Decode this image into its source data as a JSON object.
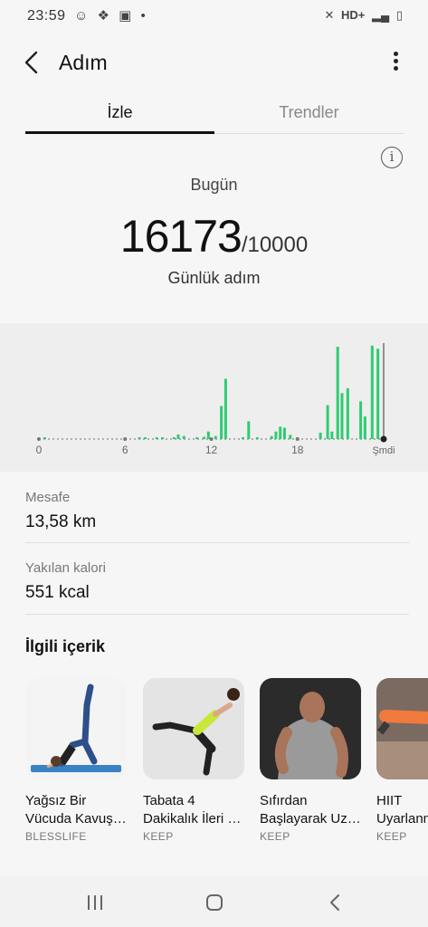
{
  "status_bar": {
    "time": "23:59",
    "network": "HD+"
  },
  "header": {
    "title": "Adım"
  },
  "tabs": [
    {
      "label": "İzle",
      "active": true
    },
    {
      "label": "Trendler",
      "active": false
    }
  ],
  "summary": {
    "day_label": "Bugün",
    "steps": "16173",
    "goal": "/10000",
    "caption": "Günlük adım"
  },
  "chart_data": {
    "type": "bar",
    "x_ticks": [
      "0",
      "6",
      "12",
      "18",
      "Şmdi"
    ],
    "x_range": [
      0,
      24
    ],
    "bar_color": "#2ecc71",
    "bars": [
      {
        "x": 0.4,
        "v": 40
      },
      {
        "x": 7.0,
        "v": 20
      },
      {
        "x": 7.4,
        "v": 20
      },
      {
        "x": 8.2,
        "v": 30
      },
      {
        "x": 8.6,
        "v": 30
      },
      {
        "x": 9.4,
        "v": 40
      },
      {
        "x": 9.7,
        "v": 120
      },
      {
        "x": 10.1,
        "v": 80
      },
      {
        "x": 11.0,
        "v": 30
      },
      {
        "x": 11.5,
        "v": 60
      },
      {
        "x": 11.8,
        "v": 200
      },
      {
        "x": 12.3,
        "v": 80
      },
      {
        "x": 12.7,
        "v": 880
      },
      {
        "x": 13.0,
        "v": 1600
      },
      {
        "x": 14.2,
        "v": 40
      },
      {
        "x": 14.6,
        "v": 470
      },
      {
        "x": 15.2,
        "v": 20
      },
      {
        "x": 16.2,
        "v": 80
      },
      {
        "x": 16.5,
        "v": 200
      },
      {
        "x": 16.8,
        "v": 330
      },
      {
        "x": 17.1,
        "v": 300
      },
      {
        "x": 17.5,
        "v": 110
      },
      {
        "x": 18.0,
        "v": 40
      },
      {
        "x": 19.6,
        "v": 170
      },
      {
        "x": 20.1,
        "v": 900
      },
      {
        "x": 20.4,
        "v": 200
      },
      {
        "x": 20.8,
        "v": 2450
      },
      {
        "x": 21.1,
        "v": 1220
      },
      {
        "x": 21.5,
        "v": 1350
      },
      {
        "x": 22.4,
        "v": 1000
      },
      {
        "x": 22.7,
        "v": 600
      },
      {
        "x": 23.2,
        "v": 2480
      },
      {
        "x": 23.6,
        "v": 2400
      }
    ]
  },
  "stats": [
    {
      "label": "Mesafe",
      "value": "13,58 km"
    },
    {
      "label": "Yakılan kalori",
      "value": "551 kcal"
    }
  ],
  "related": {
    "title": "İlgili içerik",
    "cards": [
      {
        "line1": "Yağsız Bir",
        "line2": "Vücuda Kavuşun",
        "source": "BLESSLIFE"
      },
      {
        "line1": "Tabata 4",
        "line2": "Dakikalık İleri Seviye",
        "source": "KEEP"
      },
      {
        "line1": "Sıfırdan",
        "line2": "Başlayarak Uzmanlaşın",
        "source": "KEEP"
      },
      {
        "line1": "HIIT",
        "line2": "Uyarlanmış",
        "source": "KEEP"
      }
    ]
  }
}
